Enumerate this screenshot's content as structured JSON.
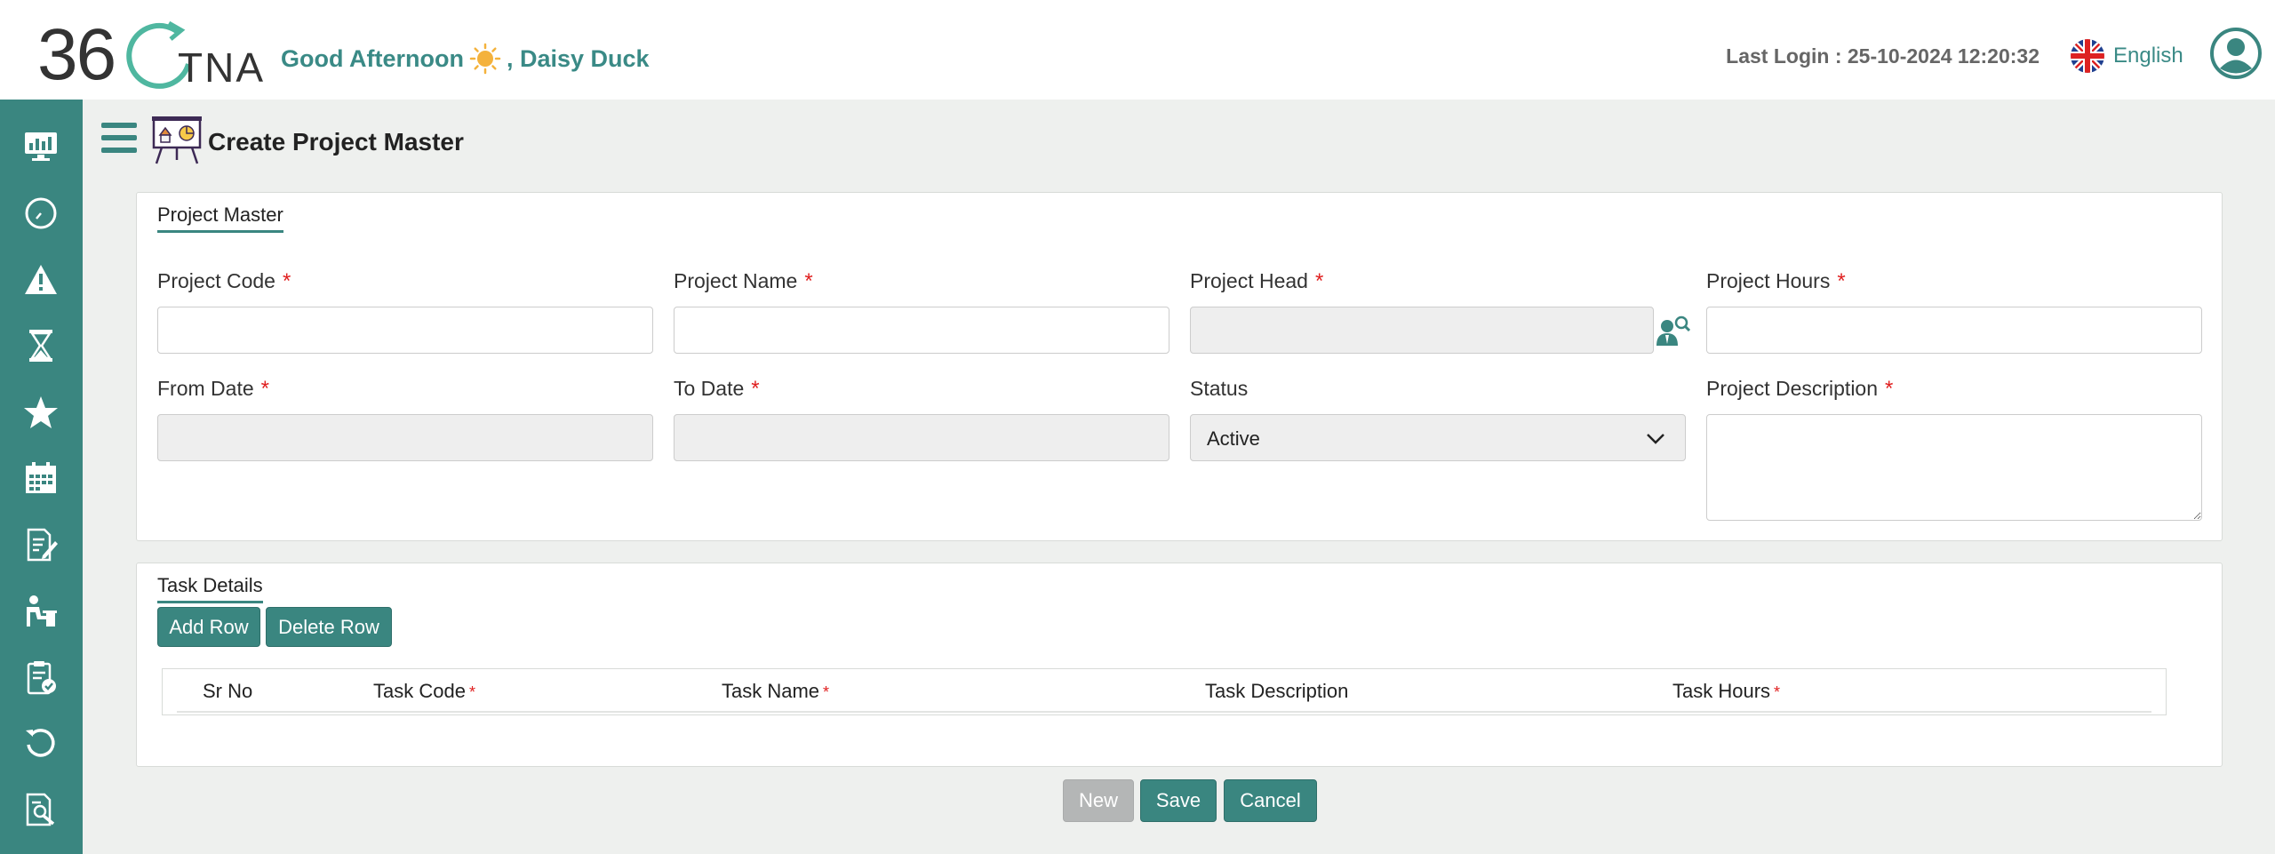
{
  "header": {
    "logo_number": "36",
    "logo_text": "TNA",
    "greeting": "Good Afternoon",
    "user_name": ", Daisy Duck",
    "last_login_label": "Last Login : 25-10-2024 12:20:32",
    "language": "English"
  },
  "sidebar": {
    "items": [
      {
        "icon": "dashboard-monitor-icon"
      },
      {
        "icon": "clock-icon"
      },
      {
        "icon": "warning-icon"
      },
      {
        "icon": "hourglass-icon"
      },
      {
        "icon": "star-icon"
      },
      {
        "icon": "calendar-icon"
      },
      {
        "icon": "edit-document-icon"
      },
      {
        "icon": "person-desk-icon"
      },
      {
        "icon": "clipboard-check-icon"
      },
      {
        "icon": "refresh-icon"
      },
      {
        "icon": "document-search-icon"
      }
    ]
  },
  "page": {
    "title": "Create Project Master"
  },
  "project_master": {
    "legend": "Project Master",
    "fields": {
      "project_code": {
        "label": "Project Code",
        "required": "*",
        "value": ""
      },
      "project_name": {
        "label": "Project Name",
        "required": "*",
        "value": ""
      },
      "project_head": {
        "label": "Project Head",
        "required": "*",
        "value": ""
      },
      "project_hours": {
        "label": "Project Hours",
        "required": "*",
        "value": ""
      },
      "from_date": {
        "label": "From Date",
        "required": "*",
        "value": ""
      },
      "to_date": {
        "label": "To Date",
        "required": "*",
        "value": ""
      },
      "status": {
        "label": "Status",
        "value": "Active"
      },
      "project_description": {
        "label": "Project Description",
        "required": "*",
        "value": ""
      }
    }
  },
  "task_details": {
    "legend": "Task Details",
    "add_row": "Add Row",
    "delete_row": "Delete Row",
    "columns": [
      {
        "label": "Sr No",
        "required": ""
      },
      {
        "label": "Task Code",
        "required": "*"
      },
      {
        "label": "Task Name",
        "required": "*"
      },
      {
        "label": "Task Description",
        "required": ""
      },
      {
        "label": "Task Hours",
        "required": "*"
      }
    ]
  },
  "footer_buttons": {
    "new": "New",
    "save": "Save",
    "cancel": "Cancel"
  },
  "colors": {
    "primary": "#3a8680",
    "required": "#e02020",
    "greeting": "#3a8a86"
  }
}
